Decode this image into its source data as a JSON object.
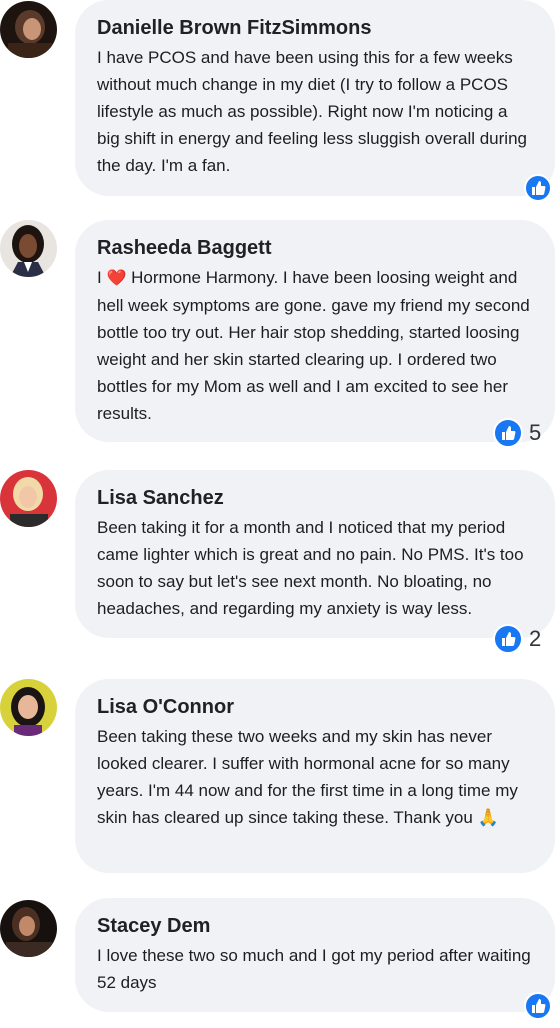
{
  "comments": [
    {
      "author": "Danielle Brown FitzSimmons",
      "text": "I have PCOS and have been using this for a few weeks without much change in my diet (I try to follow a PCOS lifestyle as much as possible). Right now I'm noticing a big shift in energy and feeling less sluggish overall during the day. I'm a fan.",
      "likes": "",
      "avatar_color": "#3a2418"
    },
    {
      "author": "Rasheeda Baggett",
      "text_before": "I ",
      "heart": "❤️",
      "text_after": " Hormone Harmony. I have been loosing weight and hell week symptoms are gone. gave my friend my second bottle too try out. Her hair stop shedding, started loosing weight and her skin started clearing up. I ordered two bottles for my Mom as well and I am excited to see her results.",
      "likes": "5",
      "avatar_color": "#2b1d16"
    },
    {
      "author": "Lisa Sanchez",
      "text": "Been taking it for a month and I noticed that my period came lighter which is great and no pain. No PMS. It's too soon to say but let's see next month. No bloating, no headaches, and regarding my anxiety is way less.",
      "likes": "2",
      "avatar_color": "#d8343a"
    },
    {
      "author": "Lisa O'Connor",
      "text": "Been taking these two weeks and my skin has never looked clearer. I suffer with hormonal acne for so many years. I'm 44 now and for the first time in a long time my skin has cleared up since taking these. Thank you 🙏",
      "likes": "",
      "avatar_color": "#c9c23a"
    },
    {
      "author": "Stacey Dem",
      "text": "I love these two so much and I got my period after waiting 52 days",
      "likes": "",
      "avatar_color": "#2a1f1a"
    }
  ],
  "like_icon": "thumbs-up-icon",
  "accent": "#1877f2"
}
